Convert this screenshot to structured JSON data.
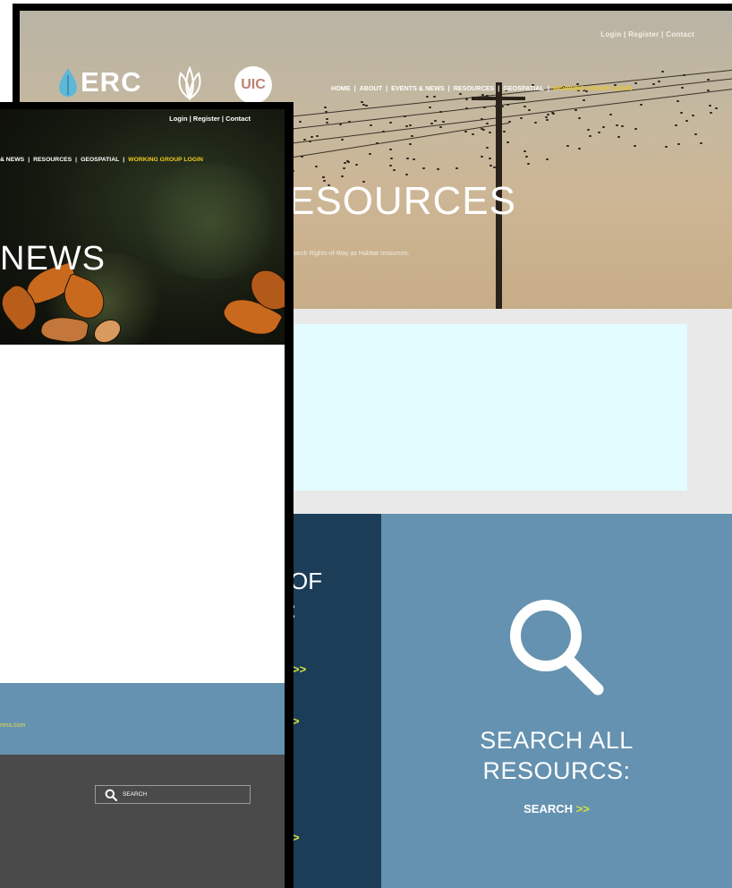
{
  "back_page": {
    "top_links": "Login  |  Register  |  Contact",
    "logos": {
      "erc": "ERC",
      "uic": "UIC",
      "leaf": "leaf-logo-icon"
    },
    "nav": [
      {
        "label": "HOME",
        "highlight": false
      },
      {
        "label": "ABOUT",
        "highlight": false
      },
      {
        "label": "EVENTS & NEWS",
        "highlight": false
      },
      {
        "label": "RESOURCES",
        "highlight": false
      },
      {
        "label": "GEOSPATIAL",
        "highlight": false
      },
      {
        "label": "WORKING GROUP LOGIN",
        "highlight": true
      }
    ],
    "title": "ESOURCES",
    "subtitle": "earch Rights-of-Way as Habitat resources.",
    "left_column": {
      "heading_line1": "OF",
      "heading_line2": ":",
      "arrows": [
        ">>",
        ">",
        ">"
      ]
    },
    "search_panel": {
      "icon": "search-icon",
      "heading_line1": "SEARCH ALL",
      "heading_line2": "RESOURCS:",
      "link_label": "SEARCH",
      "link_arrow": ">>"
    },
    "colors": {
      "dark_blue": "#1c3d58",
      "light_blue": "#6592b0",
      "accent_yellow": "#d8e23a",
      "info_box": "#e3fcff"
    }
  },
  "front_page": {
    "top_links": "Login  |  Register  |  Contact",
    "nav": [
      {
        "label": "& NEWS",
        "highlight": false
      },
      {
        "label": "RESOURCES",
        "highlight": false
      },
      {
        "label": "GEOSPATIAL",
        "highlight": false
      },
      {
        "label": "WORKING GROUP LOGIN",
        "highlight": true
      }
    ],
    "title": "NEWS",
    "band_link": "ress.com",
    "footer_search": {
      "placeholder": "SEARCH",
      "icon": "search-icon"
    },
    "colors": {
      "footer": "#4a4a4a",
      "band": "#6592b0",
      "nav_highlight": "#f0cd1c"
    }
  }
}
